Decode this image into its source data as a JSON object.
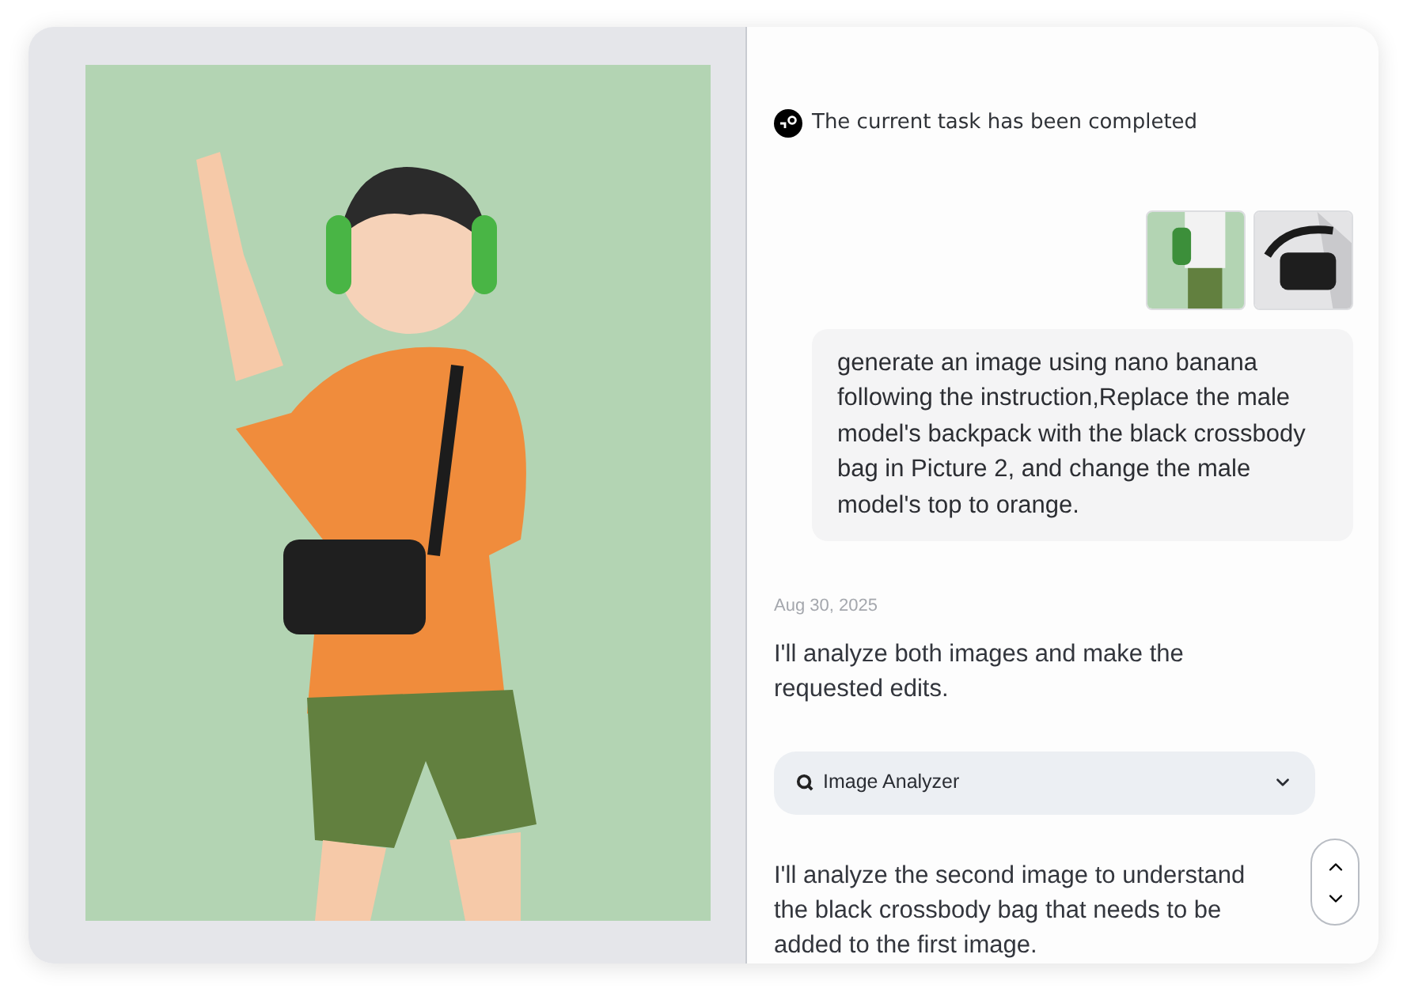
{
  "status": {
    "text": "The current task has been completed"
  },
  "user_message": "generate an image using nano banana following the instruction,Replace the male model's backpack with the black crossbody bag in Picture 2, and change the male model's top to orange.",
  "date": "Aug 30, 2025",
  "messages": [
    {
      "kind": "text",
      "text": "I'll analyze both images and make the requested edits."
    },
    {
      "kind": "tool",
      "label": "Image Analyzer",
      "expanded": false
    },
    {
      "kind": "text",
      "text": "I'll analyze the second image to understand the black crossbody bag that needs to be added to the first image."
    }
  ]
}
